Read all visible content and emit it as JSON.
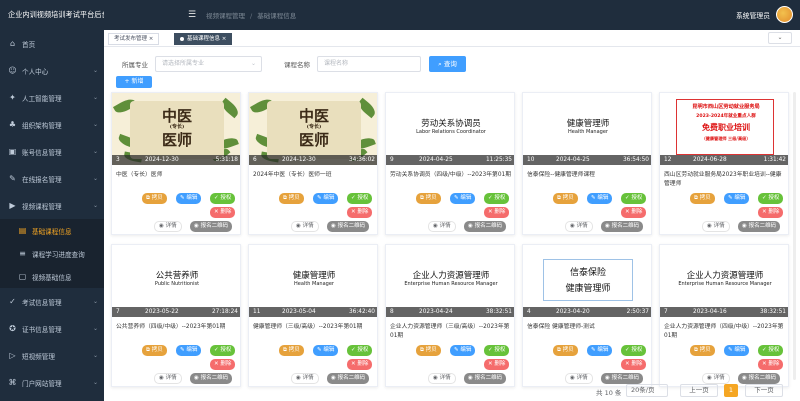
{
  "app_title": "企业内训视频培训考试平台后台管理",
  "breadcrumbs": [
    "视频课程管理",
    "基础课程信息"
  ],
  "user_name": "系统管理员",
  "menu": [
    {
      "label": "首页",
      "icon": "home-icon",
      "glyph": "⌂",
      "arrow": false
    },
    {
      "label": "个人中心",
      "icon": "user-icon",
      "glyph": "☺",
      "arrow": true
    },
    {
      "label": "人工智能管理",
      "icon": "ai-icon",
      "glyph": "✦",
      "arrow": true
    },
    {
      "label": "组织架构管理",
      "icon": "org-icon",
      "glyph": "♣",
      "arrow": true
    },
    {
      "label": "账号信息管理",
      "icon": "account-icon",
      "glyph": "▣",
      "arrow": true
    },
    {
      "label": "在线报名管理",
      "icon": "signup-icon",
      "glyph": "✎",
      "arrow": true
    },
    {
      "label": "视频课程管理",
      "icon": "video-icon",
      "glyph": "▶",
      "arrow": true
    }
  ],
  "submenu": [
    {
      "label": "基础课程信息",
      "icon": "course-icon",
      "glyph": "▤",
      "active": true
    },
    {
      "label": "课程学习进度查询",
      "icon": "progress-icon",
      "glyph": "≡",
      "active": false
    },
    {
      "label": "视频基础信息",
      "icon": "video-info-icon",
      "glyph": "▢",
      "active": false
    }
  ],
  "menu_bottom": [
    {
      "label": "考试信息管理",
      "icon": "exam-icon",
      "glyph": "✓",
      "arrow": true
    },
    {
      "label": "证书信息管理",
      "icon": "cert-icon",
      "glyph": "✪",
      "arrow": true
    },
    {
      "label": "短视频管理",
      "icon": "shortvideo-icon",
      "glyph": "▷",
      "arrow": true
    },
    {
      "label": "门户网站管理",
      "icon": "portal-icon",
      "glyph": "⌘",
      "arrow": true
    }
  ],
  "tabs": [
    {
      "label": "考试发布管理",
      "active": false
    },
    {
      "label": "基础课程信息",
      "active": true
    }
  ],
  "filter": {
    "major_label": "所属专业",
    "major_placeholder": "请选择所属专业",
    "course_label": "课程名称",
    "course_placeholder": "课程名称",
    "search_label": "查询"
  },
  "add_label": "+ 新增",
  "actions": {
    "copy": "拷贝",
    "edit": "编辑",
    "auth": "授权",
    "delete": "删除",
    "detail": "详情",
    "qr": "报名二维码"
  },
  "cards": [
    {
      "num": "3",
      "date": "2024-12-30",
      "time": "5:31:18",
      "title": "中医（专长）医师",
      "thumb": "tcm",
      "lines": [
        "中医",
        "(专长)",
        "医师"
      ]
    },
    {
      "num": "6",
      "date": "2024-12-30",
      "time": "34:36:02",
      "title": "2024年中医（专长）医师一班",
      "thumb": "tcm",
      "lines": [
        "中医",
        "(专长)",
        "医师"
      ]
    },
    {
      "num": "9",
      "date": "2024-04-25",
      "time": "11:25:35",
      "title": "劳动关系协调员（四级/中级）--2023年第01期",
      "thumb": "plain",
      "lines": [
        "劳动关系协调员",
        "Labor Relations Coordinator"
      ]
    },
    {
      "num": "10",
      "date": "2024-04-25",
      "time": "36:54:50",
      "title": "信泰保险--健康管理师课程",
      "thumb": "plain",
      "lines": [
        "健康管理师",
        "Health Manager"
      ]
    },
    {
      "num": "12",
      "date": "2024-06-28",
      "time": "1:31:42",
      "title": "西山区劳动就业服务局2023年职业培训--健康管理师",
      "thumb": "red",
      "lines": [
        "昆明市西山区劳动就业服务局",
        "2023-2024年就业重点人群",
        "免费职业培训",
        "（健康管理师 三级/高级）"
      ]
    },
    {
      "num": "7",
      "date": "2023-05-22",
      "time": "27:18:24",
      "title": "公共营养师（四级/中级）--2023年第01期",
      "thumb": "plain",
      "lines": [
        "公共营养师",
        "Public Nutritionist"
      ]
    },
    {
      "num": "11",
      "date": "2023-05-04",
      "time": "36:42:40",
      "title": "健康管理师（三级/高级）--2023年第01期",
      "thumb": "plain",
      "lines": [
        "健康管理师",
        "Health Manager"
      ]
    },
    {
      "num": "8",
      "date": "2023-04-24",
      "time": "38:32:51",
      "title": "企业人力资源管理师（三级/高级）--2023年第01期",
      "thumb": "plain",
      "lines": [
        "企业人力资源管理师",
        "Enterprise Human Resource Manager"
      ]
    },
    {
      "num": "4",
      "date": "2023-04-20",
      "time": "2:50:37",
      "title": "信泰保险 健康管理师-测试",
      "thumb": "boxed",
      "lines": [
        "信泰保险",
        "健康管理师"
      ]
    },
    {
      "num": "7",
      "date": "2023-04-16",
      "time": "38:32:51",
      "title": "企业人力资源管理师（四级/中级）--2023年第01期",
      "thumb": "plain",
      "lines": [
        "企业人力资源管理师",
        "Enterprise Human Resource Manager"
      ]
    }
  ],
  "pager": {
    "total": "共 10 条",
    "size": "20条/页",
    "prev": "上一页",
    "page": "1",
    "next": "下一页"
  },
  "colors": {
    "accent": "#f5a623",
    "primary": "#409eff",
    "sidebar": "#1f2d3d"
  }
}
